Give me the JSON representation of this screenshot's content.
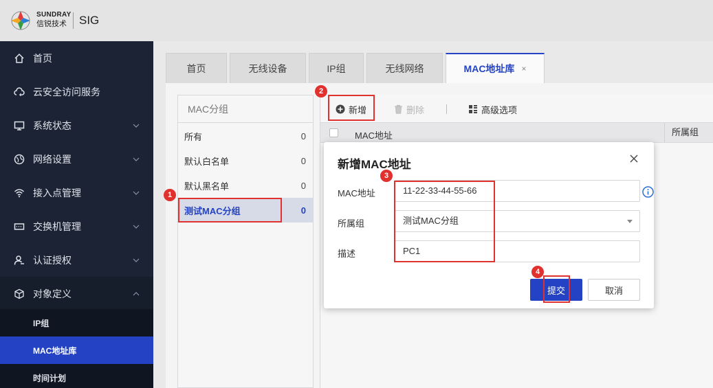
{
  "header": {
    "brand_en": "SUNDRAY",
    "brand_cn": "信锐技术",
    "product": "SIG",
    "brand_colors": [
      "#e23c3a",
      "#f5a623",
      "#3a9b45",
      "#2a7fd4"
    ]
  },
  "sidebar": {
    "items": [
      {
        "label": "首页",
        "icon": "home-icon"
      },
      {
        "label": "云安全访问服务",
        "icon": "cloud-shield-icon"
      },
      {
        "label": "系统状态",
        "icon": "monitor-icon"
      },
      {
        "label": "网络设置",
        "icon": "globe-icon"
      },
      {
        "label": "接入点管理",
        "icon": "wifi-icon"
      },
      {
        "label": "交换机管理",
        "icon": "switch-icon"
      },
      {
        "label": "认证授权",
        "icon": "user-icon"
      },
      {
        "label": "对象定义",
        "icon": "cube-icon"
      }
    ],
    "sub_items": [
      {
        "label": "IP组"
      },
      {
        "label": "MAC地址库",
        "active": true
      },
      {
        "label": "时间计划"
      }
    ]
  },
  "tabs": [
    {
      "label": "首页"
    },
    {
      "label": "无线设备"
    },
    {
      "label": "IP组"
    },
    {
      "label": "无线网络"
    },
    {
      "label": "MAC地址库",
      "active": true,
      "close": "×"
    }
  ],
  "groups": {
    "title": "MAC分组",
    "rows": [
      {
        "name": "所有",
        "count": "0"
      },
      {
        "name": "默认白名单",
        "count": "0"
      },
      {
        "name": "默认黑名单",
        "count": "0"
      },
      {
        "name": "测试MAC分组",
        "count": "0",
        "selected": true
      }
    ]
  },
  "toolbar": {
    "add_label": "新增",
    "delete_label": "删除",
    "advanced_label": "高级选项"
  },
  "table": {
    "col_mac": "MAC地址",
    "col_group": "所属组"
  },
  "modal": {
    "title": "新增MAC地址",
    "mac_label": "MAC地址",
    "mac_value": "11-22-33-44-55-66",
    "group_label": "所属组",
    "group_value": "测试MAC分组",
    "desc_label": "描述",
    "desc_value": "PC1",
    "submit_label": "提交",
    "cancel_label": "取消"
  },
  "annotations": {
    "steps": [
      "1",
      "2",
      "3",
      "4"
    ],
    "color": "#e0312f"
  },
  "accent_color": "#2443c4"
}
